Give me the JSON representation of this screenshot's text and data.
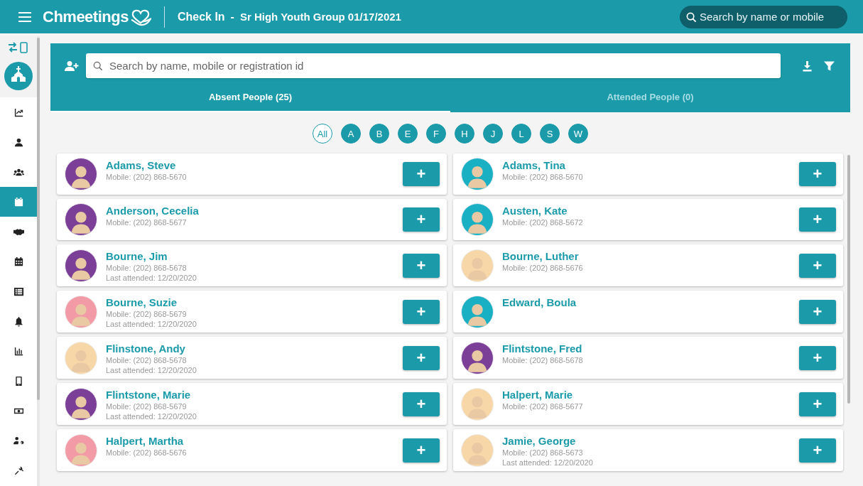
{
  "top_bar": {
    "brand": "Chmeetings",
    "page_title": "Check In",
    "separator": "-",
    "event": "Sr High Youth Group 01/17/2021",
    "search": {
      "placeholder": "Search by name or mobile"
    }
  },
  "sidebar": {
    "items": [
      {
        "selected": false
      },
      {
        "selected": false
      },
      {
        "selected": false
      },
      {
        "selected": true
      },
      {
        "selected": false
      },
      {
        "selected": false
      },
      {
        "selected": false
      },
      {
        "selected": false
      },
      {
        "selected": false
      },
      {
        "selected": false
      },
      {
        "selected": false
      },
      {
        "selected": false
      },
      {
        "selected": false
      }
    ]
  },
  "search": {
    "placeholder": "Search by name, mobile or registration id"
  },
  "tabs": [
    {
      "label": "Absent People (25)",
      "selected": true
    },
    {
      "label": "Attended People (0)",
      "selected": false
    }
  ],
  "letters": [
    {
      "label": "All",
      "selected": true
    },
    {
      "label": "A",
      "selected": false
    },
    {
      "label": "B",
      "selected": false
    },
    {
      "label": "E",
      "selected": false
    },
    {
      "label": "F",
      "selected": false
    },
    {
      "label": "H",
      "selected": false
    },
    {
      "label": "J",
      "selected": false
    },
    {
      "label": "L",
      "selected": false
    },
    {
      "label": "S",
      "selected": false
    },
    {
      "label": "W",
      "selected": false
    }
  ],
  "people": [
    {
      "name": "Adams, Steve",
      "lines": [
        "Mobile: (202) 868-5670"
      ],
      "color": "#7b3f98",
      "button": "+"
    },
    {
      "name": "Adams, Tina",
      "lines": [
        "Mobile: (202) 868-5670"
      ],
      "color": "#1ab0c4",
      "button": "+"
    },
    {
      "name": "Anderson, Cecelia",
      "lines": [
        "Mobile: (202) 868-5677"
      ],
      "color": "#7b3f98",
      "button": "+"
    },
    {
      "name": "Austen, Kate",
      "lines": [
        "Mobile: (202) 868-5672"
      ],
      "color": "#1ab0c4",
      "button": "+"
    },
    {
      "name": "Bourne, Jim",
      "lines": [
        "Mobile: (202) 868-5678",
        "Last attended: 12/20/2020"
      ],
      "color": "#7b3f98",
      "button": "+"
    },
    {
      "name": "Bourne, Luther",
      "lines": [
        "Mobile: (202) 868-5676"
      ],
      "color": "#f7d7a8",
      "button": "+"
    },
    {
      "name": "Bourne, Suzie",
      "lines": [
        "Mobile: (202) 868-5679",
        "Last attended: 12/20/2020"
      ],
      "color": "#f29aa6",
      "button": "+"
    },
    {
      "name": "Edward, Boula",
      "color": "#1ab0c4",
      "button": "+"
    },
    {
      "name": "Flinstone, Andy",
      "lines": [
        "Mobile: (202) 868-5678",
        "Last attended: 12/20/2020"
      ],
      "color": "#f7d7a8",
      "button": "+"
    },
    {
      "name": "Flintstone, Fred",
      "lines": [
        "Mobile: (202) 868-5678"
      ],
      "color": "#7b3f98",
      "button": "+"
    },
    {
      "name": "Flintstone, Marie",
      "lines": [
        "Mobile: (202) 868-5679",
        "Last attended: 12/20/2020"
      ],
      "color": "#7b3f98",
      "button": "+"
    },
    {
      "name": "Halpert, Marie",
      "lines": [
        "Mobile: (202) 868-5677"
      ],
      "color": "#f7d7a8",
      "button": "+"
    },
    {
      "name": "Halpert, Martha",
      "lines": [
        "Mobile: (202) 868-5676"
      ],
      "color": "#f29aa6",
      "button": "+"
    },
    {
      "name": "Jamie, George",
      "lines": [
        "Mobile: (202) 868-5673",
        "Last attended: 12/20/2020"
      ],
      "color": "#f7d7a8",
      "button": "+"
    }
  ]
}
